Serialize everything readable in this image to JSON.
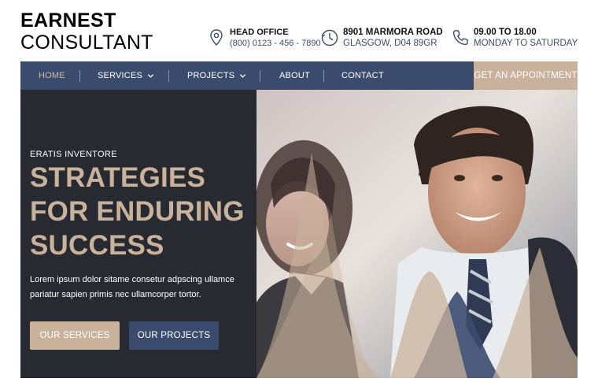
{
  "brand": {
    "line1": "EARNEST",
    "line2": "CONSULTANT"
  },
  "header_info": {
    "office": {
      "title": "HEAD OFFICE",
      "value": "(800) 0123 - 456 - 7890",
      "icon": "map-pin-icon"
    },
    "address": {
      "title": "8901 MARMORA ROAD",
      "value": "GLASGOW, D04 89GR",
      "icon": "clock-icon"
    },
    "hours": {
      "title": "09.00 TO 18.00",
      "value": "MONDAY TO SATURDAY",
      "icon": "phone-icon"
    }
  },
  "nav": {
    "items": [
      {
        "label": "HOME",
        "active": true
      },
      {
        "label": "SERVICES",
        "dropdown": true
      },
      {
        "label": "PROJECTS",
        "dropdown": true
      },
      {
        "label": "ABOUT"
      },
      {
        "label": "CONTACT"
      }
    ],
    "cta": "GET AN APPOINTMENT"
  },
  "hero": {
    "eyebrow": "ERATIS INVENTORE",
    "headline": [
      "STRATEGIES",
      "FOR ENDURING",
      "SUCCESS"
    ],
    "description": "Lorem ipsum dolor sitame consetur adpscing ullamce pariatur sapien primis nec ullamcorper tortor.",
    "primary_button": "OUR SERVICES",
    "secondary_button": "OUR PROJECTS"
  },
  "colors": {
    "navy": "#3b4b6e",
    "beige": "#c9b29b",
    "dark": "#272a30",
    "white": "#ffffff"
  }
}
